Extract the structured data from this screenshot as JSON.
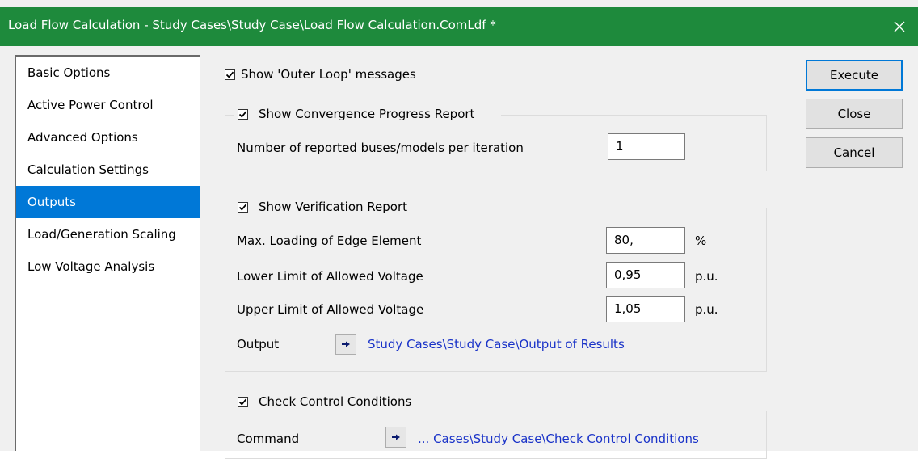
{
  "window": {
    "title": "Load Flow Calculation - Study Cases\\Study Case\\Load Flow Calculation.ComLdf *",
    "close_glyph": "close-icon",
    "title_bar_color": "#1e8a3c"
  },
  "sidebar": {
    "items": [
      {
        "label": "Basic Options",
        "active": false
      },
      {
        "label": "Active Power Control",
        "active": false
      },
      {
        "label": "Advanced Options",
        "active": false
      },
      {
        "label": "Calculation Settings",
        "active": false
      },
      {
        "label": "Outputs",
        "active": true
      },
      {
        "label": "Load/Generation Scaling",
        "active": false
      },
      {
        "label": "Low Voltage Analysis",
        "active": false
      }
    ],
    "active_color": "#0078d7"
  },
  "outer_loop": {
    "label": "Show 'Outer Loop' messages",
    "checked": true
  },
  "convergence": {
    "title": "Show Convergence Progress Report",
    "checked": true,
    "buses_label": "Number of reported buses/models per iteration",
    "buses_value": "1"
  },
  "verification": {
    "title": "Show Verification Report",
    "checked": true,
    "max_loading_label": "Max. Loading of Edge Element",
    "max_loading_value": "80,",
    "max_loading_unit": "%",
    "lower_label": "Lower Limit of Allowed Voltage",
    "lower_value": "0,95",
    "lower_unit": "p.u.",
    "upper_label": "Upper Limit of Allowed Voltage",
    "upper_value": "1,05",
    "upper_unit": "p.u.",
    "output_label": "Output",
    "output_link": "Study Cases\\Study Case\\Output of Results"
  },
  "check_control": {
    "title": "Check Control Conditions",
    "checked": true,
    "command_label": "Command",
    "command_link": "... Cases\\Study Case\\Check Control Conditions"
  },
  "buttons": {
    "execute": "Execute",
    "close": "Close",
    "cancel": "Cancel"
  },
  "link_color": "#1a33c8"
}
